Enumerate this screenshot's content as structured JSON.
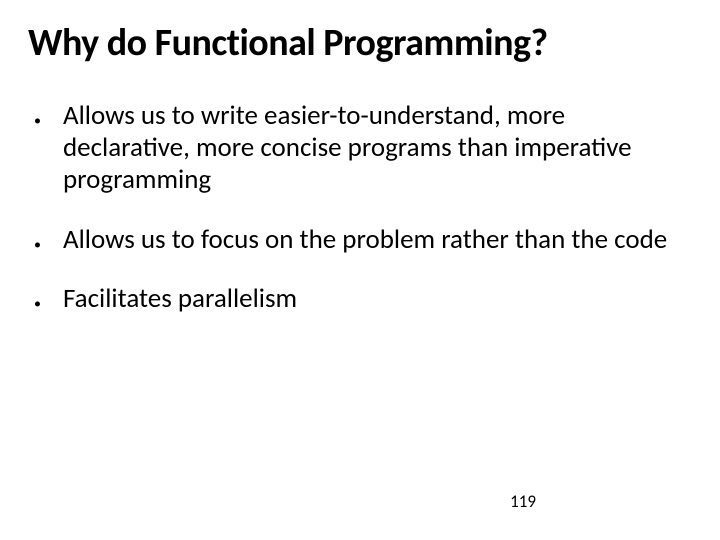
{
  "title": "Why do Functional Programming?",
  "bullets": [
    {
      "text": "Allows us to write easier-to-understand, more declarative, more concise programs than imperative programming"
    },
    {
      "text": "Allows us to focus on the problem rather than the code"
    },
    {
      "text": "Facilitates parallelism"
    }
  ],
  "page_number": "119"
}
